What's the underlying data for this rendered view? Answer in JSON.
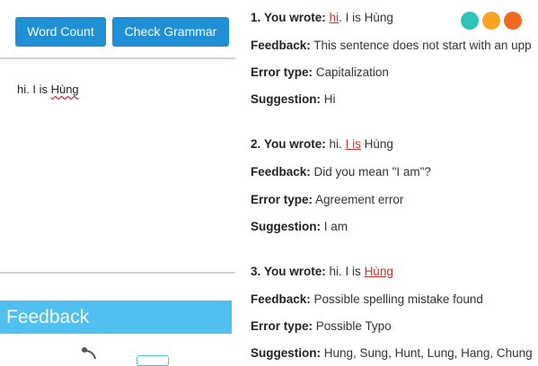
{
  "toolbar": {
    "word_count_label": "Word Count",
    "check_grammar_label": "Check Grammar"
  },
  "editor": {
    "text_before": "hi. I is ",
    "text_flagged": "Hùng"
  },
  "feedback_panel": {
    "title": "Feedback"
  },
  "status_dots": {
    "colors": [
      "#2ec4b6",
      "#f7a520",
      "#f26a21"
    ]
  },
  "results": [
    {
      "number": "1.",
      "wrote_label": "You wrote:",
      "wrote_pre": "",
      "wrote_err": "hi",
      "wrote_post": ". I is Hùng",
      "feedback_label": "Feedback:",
      "feedback": "This sentence does not start with an upp",
      "type_label": "Error type:",
      "type": "Capitalization",
      "suggestion_label": "Suggestion:",
      "suggestion": "Hi"
    },
    {
      "number": "2.",
      "wrote_label": "You wrote:",
      "wrote_pre": "hi. ",
      "wrote_err": "I is",
      "wrote_post": " Hùng",
      "feedback_label": "Feedback:",
      "feedback": "Did you mean \"I am\"?",
      "type_label": "Error type:",
      "type": "Agreement error",
      "suggestion_label": "Suggestion:",
      "suggestion": "I am"
    },
    {
      "number": "3.",
      "wrote_label": "You wrote:",
      "wrote_pre": "hi. I is ",
      "wrote_err": "Hùng",
      "wrote_post": "",
      "feedback_label": "Feedback:",
      "feedback": "Possible spelling mistake found",
      "type_label": "Error type:",
      "type": "Possible Typo",
      "suggestion_label": "Suggestion:",
      "suggestion": "Hung, Sung, Hunt, Lung, Hang, Chung"
    }
  ]
}
